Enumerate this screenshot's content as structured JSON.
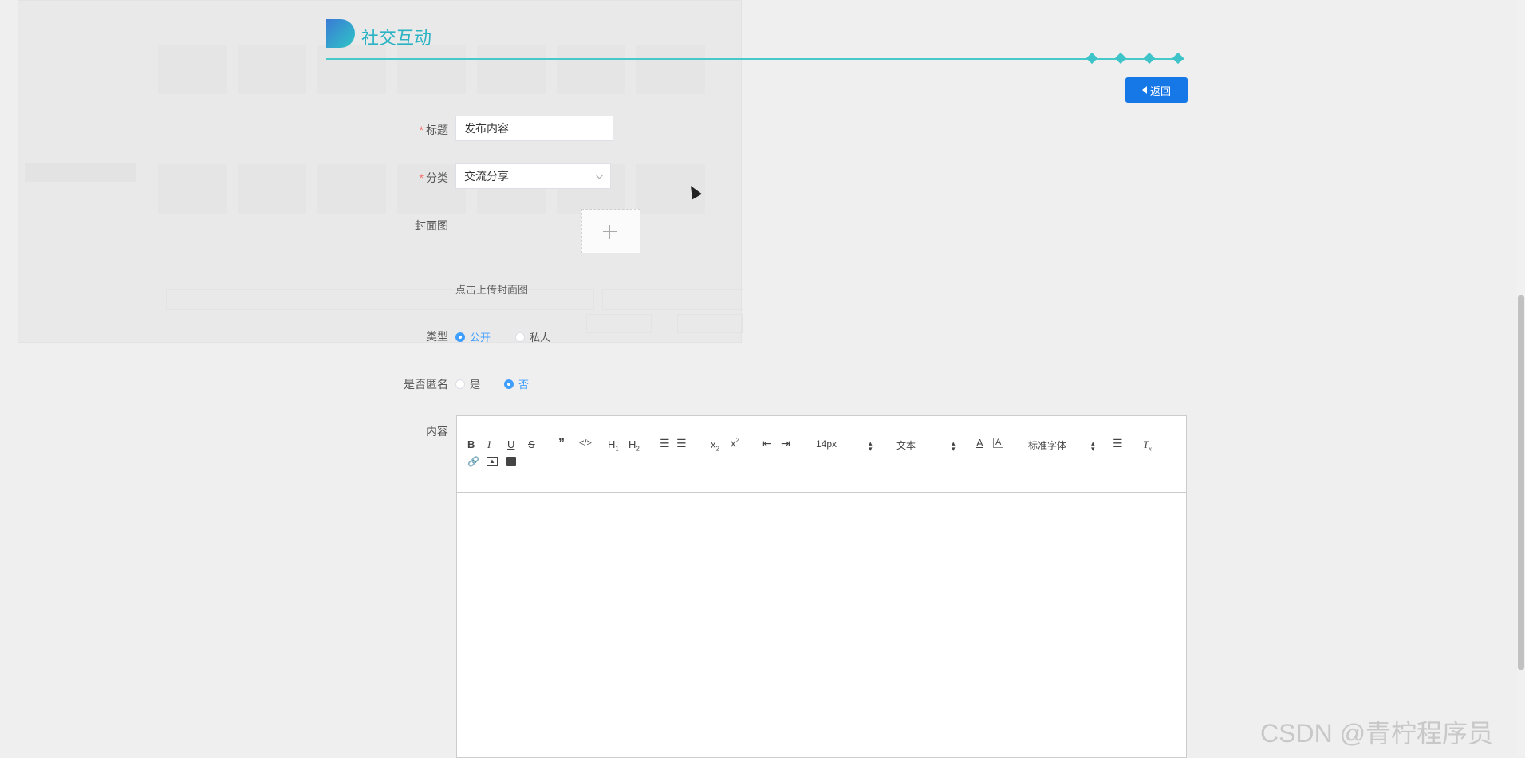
{
  "header": {
    "title": "社交互动",
    "back_label": "返回"
  },
  "form": {
    "title_label": "标题",
    "title_value": "发布内容",
    "category_label": "分类",
    "category_value": "交流分享",
    "cover_label": "封面图",
    "cover_hint": "点击上传封面图",
    "type_label": "类型",
    "type_options": [
      "公开",
      "私人"
    ],
    "type_selected": "公开",
    "anon_label": "是否匿名",
    "anon_options": [
      "是",
      "否"
    ],
    "anon_selected": "否",
    "content_label": "内容"
  },
  "editor": {
    "font_size": "14px",
    "block_format": "文本",
    "font_family": "标准字体"
  },
  "watermark": "CSDN @青柠程序员"
}
